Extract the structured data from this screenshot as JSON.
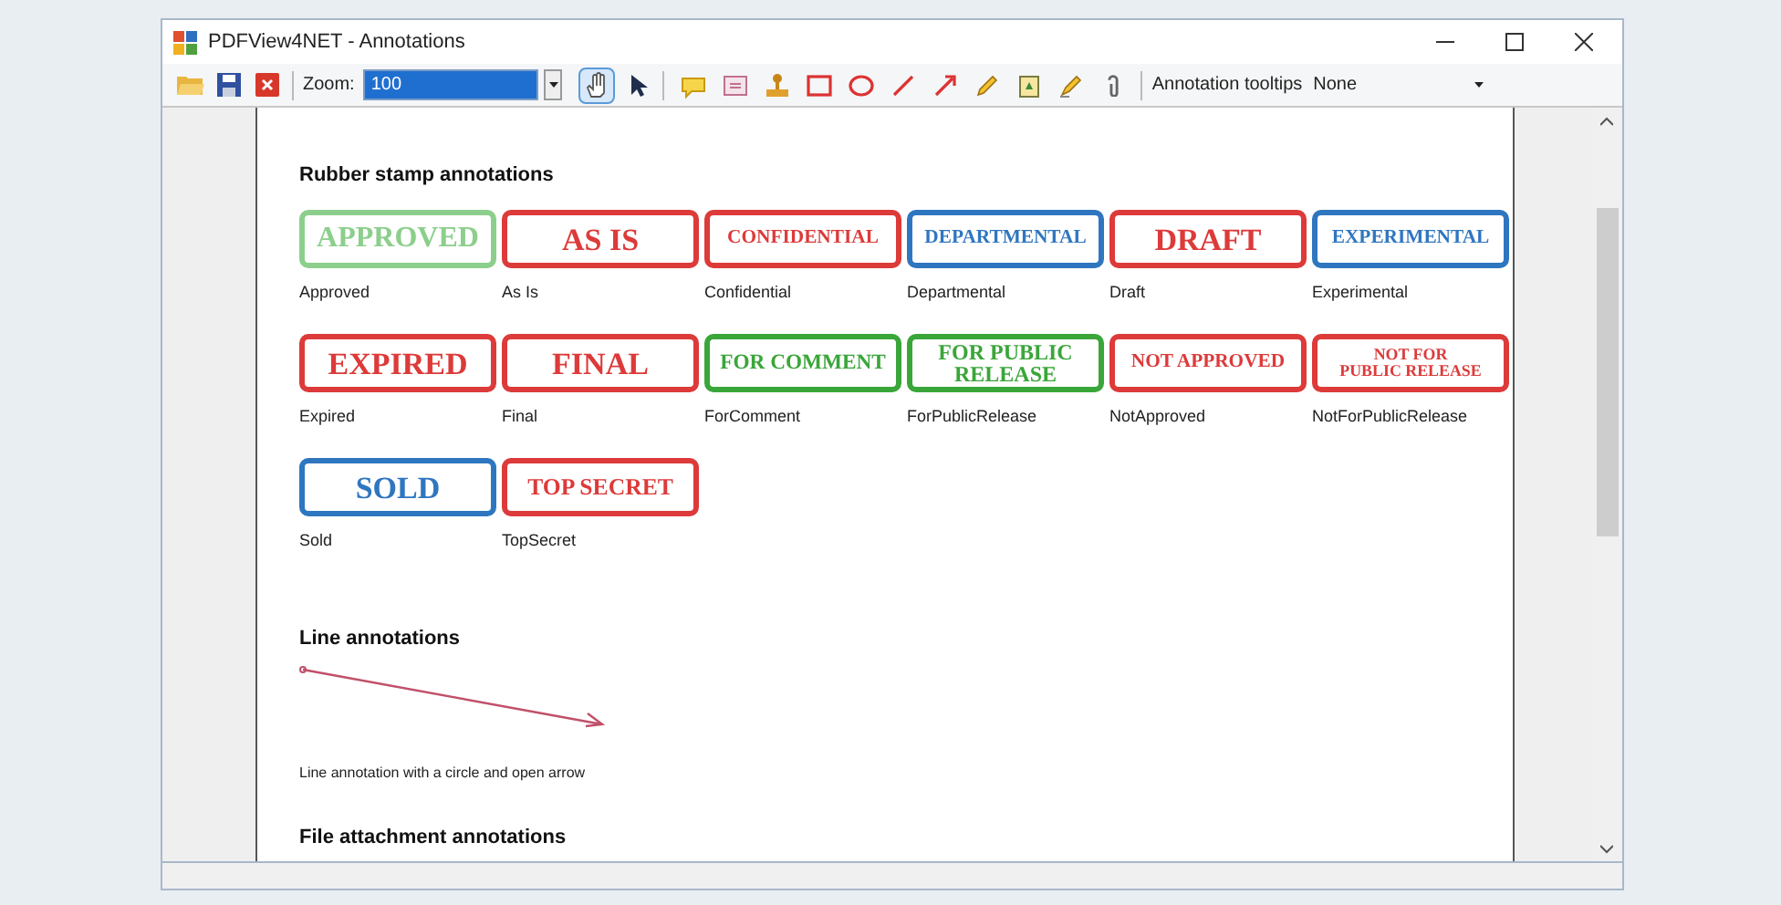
{
  "window": {
    "title": "PDFView4NET - Annotations"
  },
  "toolbar": {
    "zoom_label": "Zoom:",
    "zoom_value": "100",
    "tooltips_label": "Annotation tooltips",
    "tooltips_value": "None",
    "tools": [
      {
        "kind": "hand",
        "selected": true
      },
      {
        "kind": "pointer",
        "selected": false
      },
      {
        "kind": "note",
        "selected": false
      },
      {
        "kind": "textbox",
        "selected": false
      },
      {
        "kind": "stamp",
        "selected": false
      },
      {
        "kind": "rectangle",
        "selected": false
      },
      {
        "kind": "ellipse",
        "selected": false
      },
      {
        "kind": "line",
        "selected": false
      },
      {
        "kind": "arrow",
        "selected": false
      },
      {
        "kind": "pencil",
        "selected": false
      },
      {
        "kind": "file",
        "selected": false
      },
      {
        "kind": "highlighter",
        "selected": false
      },
      {
        "kind": "paperclip",
        "selected": false
      }
    ]
  },
  "document": {
    "sections": [
      {
        "kind": "stamps",
        "heading": "Rubber stamp annotations",
        "stamps": [
          {
            "lines": [
              "APPROVED"
            ],
            "label": "Approved",
            "color": "#8ccf8c"
          },
          {
            "lines": [
              "AS IS"
            ],
            "label": "As Is",
            "color": "#dd3a3a"
          },
          {
            "lines": [
              "CONFIDENTIAL"
            ],
            "label": "Confidential",
            "color": "#dd3a3a"
          },
          {
            "lines": [
              "DEPARTMENTAL"
            ],
            "label": "Departmental",
            "color": "#2f76c0"
          },
          {
            "lines": [
              "DRAFT"
            ],
            "label": "Draft",
            "color": "#dd3a3a"
          },
          {
            "lines": [
              "EXPERIMENTAL"
            ],
            "label": "Experimental",
            "color": "#2f76c0"
          },
          {
            "lines": [
              "EXPIRED"
            ],
            "label": "Expired",
            "color": "#dd3a3a"
          },
          {
            "lines": [
              "FINAL"
            ],
            "label": "Final",
            "color": "#dd3a3a"
          },
          {
            "lines": [
              "FOR COMMENT"
            ],
            "label": "ForComment",
            "color": "#3aa63a"
          },
          {
            "lines": [
              "FOR PUBLIC",
              "RELEASE"
            ],
            "label": "ForPublicRelease",
            "color": "#3aa63a"
          },
          {
            "lines": [
              "NOT APPROVED"
            ],
            "label": "NotApproved",
            "color": "#dd3a3a"
          },
          {
            "lines": [
              "NOT FOR",
              "PUBLIC RELEASE"
            ],
            "label": "NotForPublicRelease",
            "color": "#dd3a3a"
          },
          {
            "lines": [
              "SOLD"
            ],
            "label": "Sold",
            "color": "#2f76c0"
          },
          {
            "lines": [
              "TOP SECRET"
            ],
            "label": "TopSecret",
            "color": "#dd3a3a"
          }
        ]
      },
      {
        "kind": "line",
        "heading": "Line annotations",
        "caption": "Line annotation with a circle and open arrow"
      },
      {
        "kind": "heading_only",
        "heading": "File attachment annotations"
      }
    ]
  }
}
